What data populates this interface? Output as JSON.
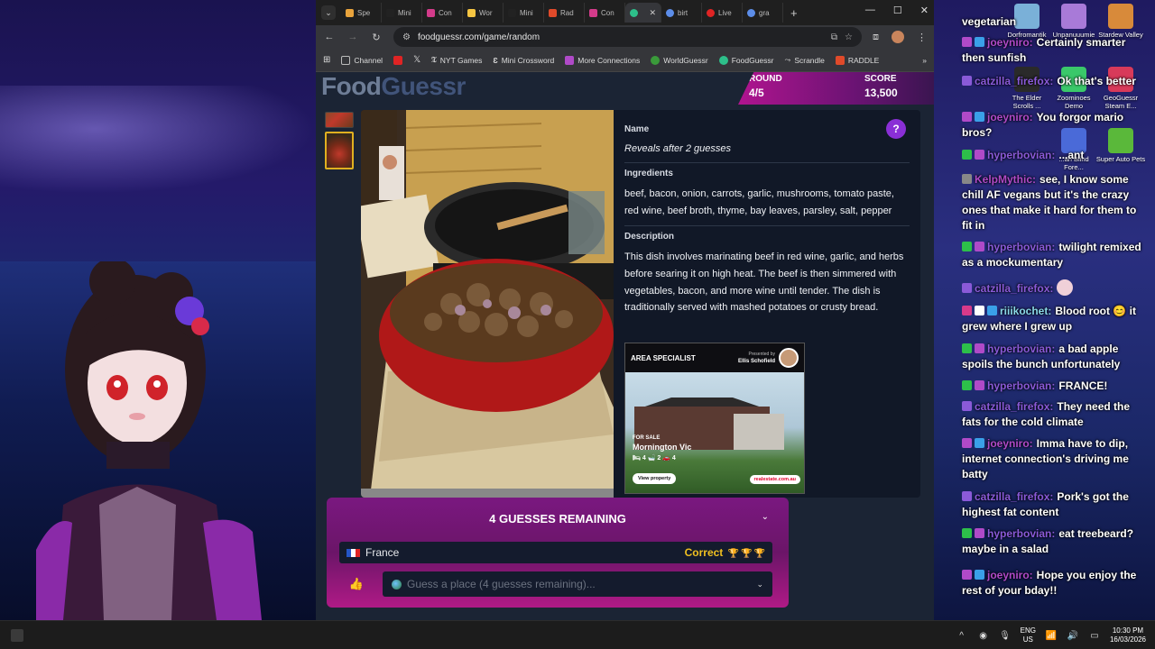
{
  "browser": {
    "tabs": [
      {
        "label": "Spe",
        "color": "#e8a33c"
      },
      {
        "label": "Mini",
        "color": "#222"
      },
      {
        "label": "Con",
        "color": "#d33b8a"
      },
      {
        "label": "Wor",
        "color": "#f5c542"
      },
      {
        "label": "Mini",
        "color": "#222"
      },
      {
        "label": "Rad",
        "color": "#e04a2a"
      },
      {
        "label": "Con",
        "color": "#d33b8a"
      },
      {
        "label": "",
        "color": "#2dbf8a"
      },
      {
        "label": "birt",
        "color": "#5c8de8"
      },
      {
        "label": "Live",
        "color": "#e02424"
      },
      {
        "label": "gra",
        "color": "#5c8de8"
      }
    ],
    "url": "foodguessr.com/game/random",
    "bookmarks": [
      {
        "label": "Channel",
        "color": "#777"
      },
      {
        "label": "",
        "color": "#e02424"
      },
      {
        "label": "",
        "color": "#111"
      },
      {
        "label": "NYT Games",
        "color": "#111"
      },
      {
        "label": "Mini Crossword",
        "color": "#111"
      },
      {
        "label": "More Connections",
        "color": "#b04ac8"
      },
      {
        "label": "WorldGuessr",
        "color": "#3a9a3a"
      },
      {
        "label": "FoodGuessr",
        "color": "#2dbf8a"
      },
      {
        "label": "Scrandle",
        "color": "#888"
      },
      {
        "label": "RADDLE",
        "color": "#e04a2a"
      }
    ]
  },
  "game": {
    "logo_food": "Food",
    "logo_guessr": "Guessr",
    "round_label": "ROUND",
    "round_value": "4/5",
    "score_label": "SCORE",
    "score_value": "13,500",
    "help": "?",
    "name_title": "Name",
    "name_value": "Reveals after 2 guesses",
    "ingredients_title": "Ingredients",
    "ingredients_value": "beef, bacon, onion, carrots, garlic, mushrooms, tomato paste, red wine, beef broth, thyme, bay leaves, parsley, salt, pepper",
    "description_title": "Description",
    "description_value": "This dish involves marinating beef in red wine, garlic, and herbs before searing it on high heat. The beef is then simmered with vegetables, bacon, and more wine until tender. The dish is traditionally served with mashed potatoes or crusty bread.",
    "guesses_remaining": "4 GUESSES REMAINING",
    "guess_country": "France",
    "guess_result": "Correct",
    "select_placeholder": "Guess a place (4 guesses remaining)..."
  },
  "ad": {
    "brand": "AREA SPECIALIST",
    "presented_by": "Presented by",
    "agent": "Ellis Schofield",
    "for_sale": "FOR SALE",
    "location": "Mornington Vic",
    "features": "🛏 4  🛁 2  🚗 4",
    "button": "View property",
    "site": "realestate.com.au"
  },
  "desktop_icons": [
    {
      "label": "Dorfromantik",
      "color": "#7ab0d8"
    },
    {
      "label": "Unpanuuumie",
      "color": "#a87ad8"
    },
    {
      "label": "Stardew Valley",
      "color": "#d88a3a"
    },
    {
      "label": "The Elder Scrolls ...",
      "color": "#2a2a2a"
    },
    {
      "label": "Zoominoes Demo",
      "color": "#3ac86a"
    },
    {
      "label": "GeoGuessr Steam E...",
      "color": "#d83a5a"
    },
    {
      "label": "...an Blind Fore...",
      "color": "#4a6ad8"
    },
    {
      "label": "Super Auto Pets",
      "color": "#5ab83a"
    }
  ],
  "chat": [
    {
      "badges": [],
      "user": "",
      "user_color": "#fff",
      "text": "vegetarian"
    },
    {
      "badges": [
        "#b04ac8",
        "#3aa0e8"
      ],
      "user": "joeyniro:",
      "user_color": "#b04ac8",
      "text": "Certainly smarter then sunfish"
    },
    {
      "badges": [
        "#8a5ad8"
      ],
      "user": "catzilla_firefox:",
      "user_color": "#8a5ad8",
      "text": "Ok that's better"
    },
    {
      "badges": [
        "#b04ac8",
        "#3aa0e8"
      ],
      "user": "joeyniro:",
      "user_color": "#b04ac8",
      "text": "You forgor mario bros?"
    },
    {
      "badges": [
        "#2dbf4a",
        "#b04ac8"
      ],
      "user": "hyperbovian:",
      "user_color": "#8a5ad8",
      "text": "...ant"
    },
    {
      "badges": [
        "#888"
      ],
      "user": "KelpMythic:",
      "user_color": "#b04ac8",
      "text": "see, I know some chill AF vegans but it's the crazy ones that make it hard for them to fit in"
    },
    {
      "badges": [
        "#2dbf4a",
        "#b04ac8"
      ],
      "user": "hyperbovian:",
      "user_color": "#8a5ad8",
      "text": "twilight remixed as a mockumentary"
    },
    {
      "badges": [
        "#8a5ad8"
      ],
      "user": "catzilla_firefox:",
      "user_color": "#8a5ad8",
      "text": ""
    },
    {
      "badges": [
        "#d83a8a",
        "#fff",
        "#3aa0e8"
      ],
      "user": "riiikochet:",
      "user_color": "#8ad8e8",
      "text": "Blood root 😊 it grew where I grew up"
    },
    {
      "badges": [
        "#2dbf4a",
        "#b04ac8"
      ],
      "user": "hyperbovian:",
      "user_color": "#8a5ad8",
      "text": "a bad apple spoils the bunch unfortunately"
    },
    {
      "badges": [
        "#2dbf4a",
        "#b04ac8"
      ],
      "user": "hyperbovian:",
      "user_color": "#8a5ad8",
      "text": "FRANCE!"
    },
    {
      "badges": [
        "#8a5ad8"
      ],
      "user": "catzilla_firefox:",
      "user_color": "#8a5ad8",
      "text": "They need the fats for the cold climate"
    },
    {
      "badges": [
        "#b04ac8",
        "#3aa0e8"
      ],
      "user": "joeyniro:",
      "user_color": "#b04ac8",
      "text": "Imma have to dip, internet connection's driving me batty"
    },
    {
      "badges": [
        "#8a5ad8"
      ],
      "user": "catzilla_firefox:",
      "user_color": "#8a5ad8",
      "text": "Pork's got the highest fat content"
    },
    {
      "badges": [
        "#2dbf4a",
        "#b04ac8"
      ],
      "user": "hyperbovian:",
      "user_color": "#8a5ad8",
      "text": "eat treebeard? maybe in a salad"
    },
    {
      "badges": [
        "#b04ac8",
        "#3aa0e8"
      ],
      "user": "joeyniro:",
      "user_color": "#b04ac8",
      "text": "Hope you enjoy the rest of your bday!!"
    }
  ],
  "taskbar": {
    "lang_top": "ENG",
    "lang_bottom": "US",
    "time": "10:30 PM",
    "date": "16/03/2026"
  }
}
